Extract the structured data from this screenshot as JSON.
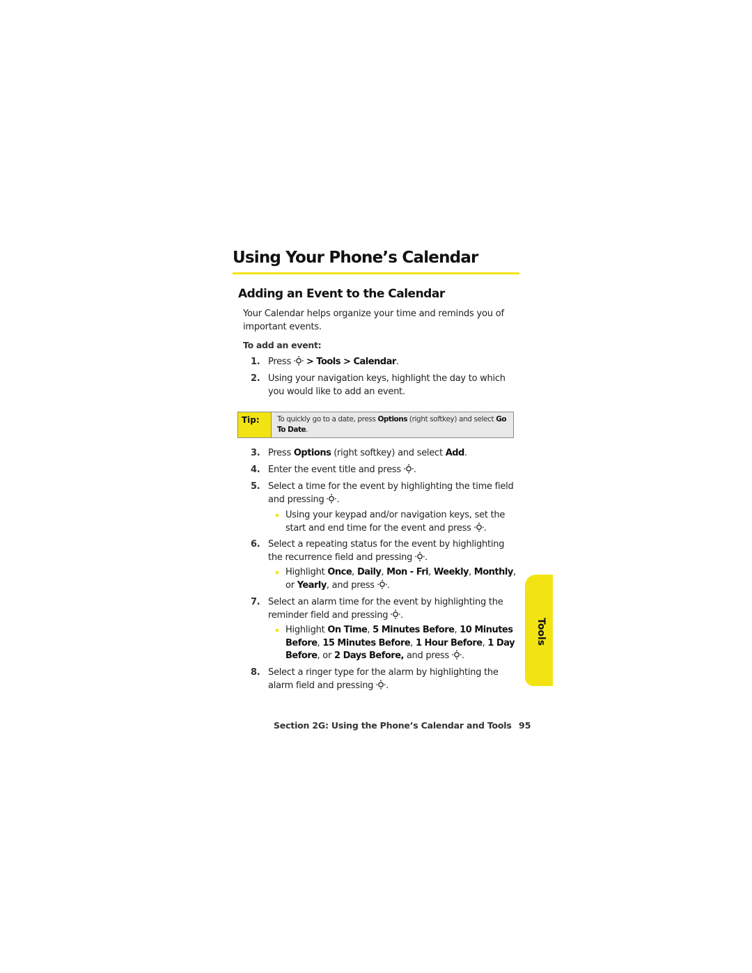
{
  "page": {
    "title": "Using Your Phone’s Calendar",
    "subtitle": "Adding an Event to the Calendar",
    "intro": "Your Calendar helps organize your time and reminds you of important events.",
    "procedure_label": "To add an event:",
    "steps": [
      {
        "num": "1.",
        "parts": [
          {
            "t": "Press "
          },
          {
            "icon": "menu-ok-key-icon"
          },
          {
            "t": " > Tools > Calendar",
            "b": true
          },
          {
            "t": "."
          }
        ]
      },
      {
        "num": "2.",
        "parts": [
          {
            "t": "Using your navigation keys, highlight the day to which you would like to add an event."
          }
        ]
      },
      {
        "num": "3.",
        "parts": [
          {
            "t": "Press "
          },
          {
            "t": "Options",
            "b": true
          },
          {
            "t": " (right softkey) and select "
          },
          {
            "t": "Add",
            "b": true
          },
          {
            "t": "."
          }
        ]
      },
      {
        "num": "4.",
        "parts": [
          {
            "t": "Enter the event title and press "
          },
          {
            "icon": "menu-ok-key-icon"
          },
          {
            "t": "."
          }
        ]
      },
      {
        "num": "5.",
        "parts": [
          {
            "t": "Select a time for the event by highlighting the time field and pressing "
          },
          {
            "icon": "menu-ok-key-icon"
          },
          {
            "t": "."
          }
        ]
      },
      {
        "num": "6.",
        "parts": [
          {
            "t": "Select a repeating status for the event by highlighting the recurrence field and pressing "
          },
          {
            "icon": "menu-ok-key-icon"
          },
          {
            "t": "."
          }
        ]
      },
      {
        "num": "7.",
        "parts": [
          {
            "t": "Select an alarm time for the event by highlighting the reminder field and pressing "
          },
          {
            "icon": "menu-ok-key-icon"
          },
          {
            "t": "."
          }
        ]
      },
      {
        "num": "8.",
        "parts": [
          {
            "t": "Select a ringer type for the alarm by highlighting the alarm field and pressing "
          },
          {
            "icon": "menu-ok-key-icon"
          },
          {
            "t": "."
          }
        ]
      }
    ],
    "bullets": [
      {
        "parts": [
          {
            "t": "Using your keypad and/or navigation keys, set the start and end time for the event and press "
          },
          {
            "icon": "menu-ok-key-icon"
          },
          {
            "t": "."
          }
        ]
      },
      {
        "parts": [
          {
            "t": "Highlight "
          },
          {
            "t": "Once",
            "b": true
          },
          {
            "t": ", "
          },
          {
            "t": "Daily",
            "b": true
          },
          {
            "t": ", "
          },
          {
            "t": "Mon - Fri",
            "b": true
          },
          {
            "t": ", "
          },
          {
            "t": "Weekly",
            "b": true
          },
          {
            "t": ", "
          },
          {
            "t": "Monthly",
            "b": true
          },
          {
            "t": ", or "
          },
          {
            "t": "Yearly",
            "b": true
          },
          {
            "t": ", and press "
          },
          {
            "icon": "menu-ok-key-icon"
          },
          {
            "t": "."
          }
        ]
      },
      {
        "parts": [
          {
            "t": "Highlight "
          },
          {
            "t": "On Time",
            "b": true
          },
          {
            "t": ", "
          },
          {
            "t": "5 Minutes Before",
            "b": true
          },
          {
            "t": ", "
          },
          {
            "t": "10 Minutes Before",
            "b": true
          },
          {
            "t": ", "
          },
          {
            "t": "15 Minutes Before",
            "b": true
          },
          {
            "t": ", "
          },
          {
            "t": "1 Hour Before",
            "b": true
          },
          {
            "t": ", "
          },
          {
            "t": "1 Day Before",
            "b": true
          },
          {
            "t": ", or "
          },
          {
            "t": "2 Days Before,",
            "b": true
          },
          {
            "t": " and press "
          },
          {
            "icon": "menu-ok-key-icon"
          },
          {
            "t": "."
          }
        ]
      }
    ],
    "tip": {
      "label": "Tip:",
      "parts": [
        {
          "t": "To quickly go to a date, press "
        },
        {
          "t": "Options",
          "b": true
        },
        {
          "t": " (right softkey) and select "
        },
        {
          "t": "Go To Date",
          "b": true
        },
        {
          "t": "."
        }
      ]
    },
    "side_tab": "Tools",
    "footer": {
      "section": "Section 2G: Using the Phone’s Calendar and Tools",
      "page_number": "95"
    },
    "colors": {
      "accent": "#f2e313",
      "tip_bg": "#e8e8e8"
    }
  }
}
